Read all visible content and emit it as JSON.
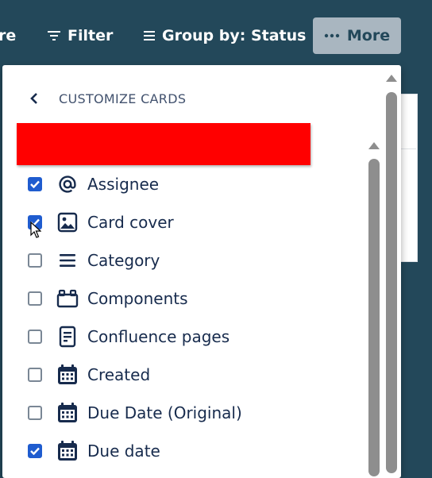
{
  "toolbar": {
    "partial_label": "re",
    "filter_label": "Filter",
    "groupby_label": "Group by: Status",
    "more_label": "More"
  },
  "panel": {
    "title": "CUSTOMIZE CARDS",
    "fields": [
      {
        "label": "Assignee",
        "checked": true,
        "icon": "at-icon"
      },
      {
        "label": "Card cover",
        "checked": true,
        "icon": "image-icon"
      },
      {
        "label": "Category",
        "checked": false,
        "icon": "lines-icon"
      },
      {
        "label": "Components",
        "checked": false,
        "icon": "components-icon"
      },
      {
        "label": "Confluence pages",
        "checked": false,
        "icon": "document-icon"
      },
      {
        "label": "Created",
        "checked": false,
        "icon": "calendar-icon"
      },
      {
        "label": "Due Date (Original)",
        "checked": false,
        "icon": "calendar-icon"
      },
      {
        "label": "Due date",
        "checked": true,
        "icon": "calendar-icon"
      }
    ]
  },
  "colors": {
    "toolbar_bg": "#23485a",
    "checkbox_checked": "#1f5ccf",
    "redaction": "#ff0000"
  }
}
